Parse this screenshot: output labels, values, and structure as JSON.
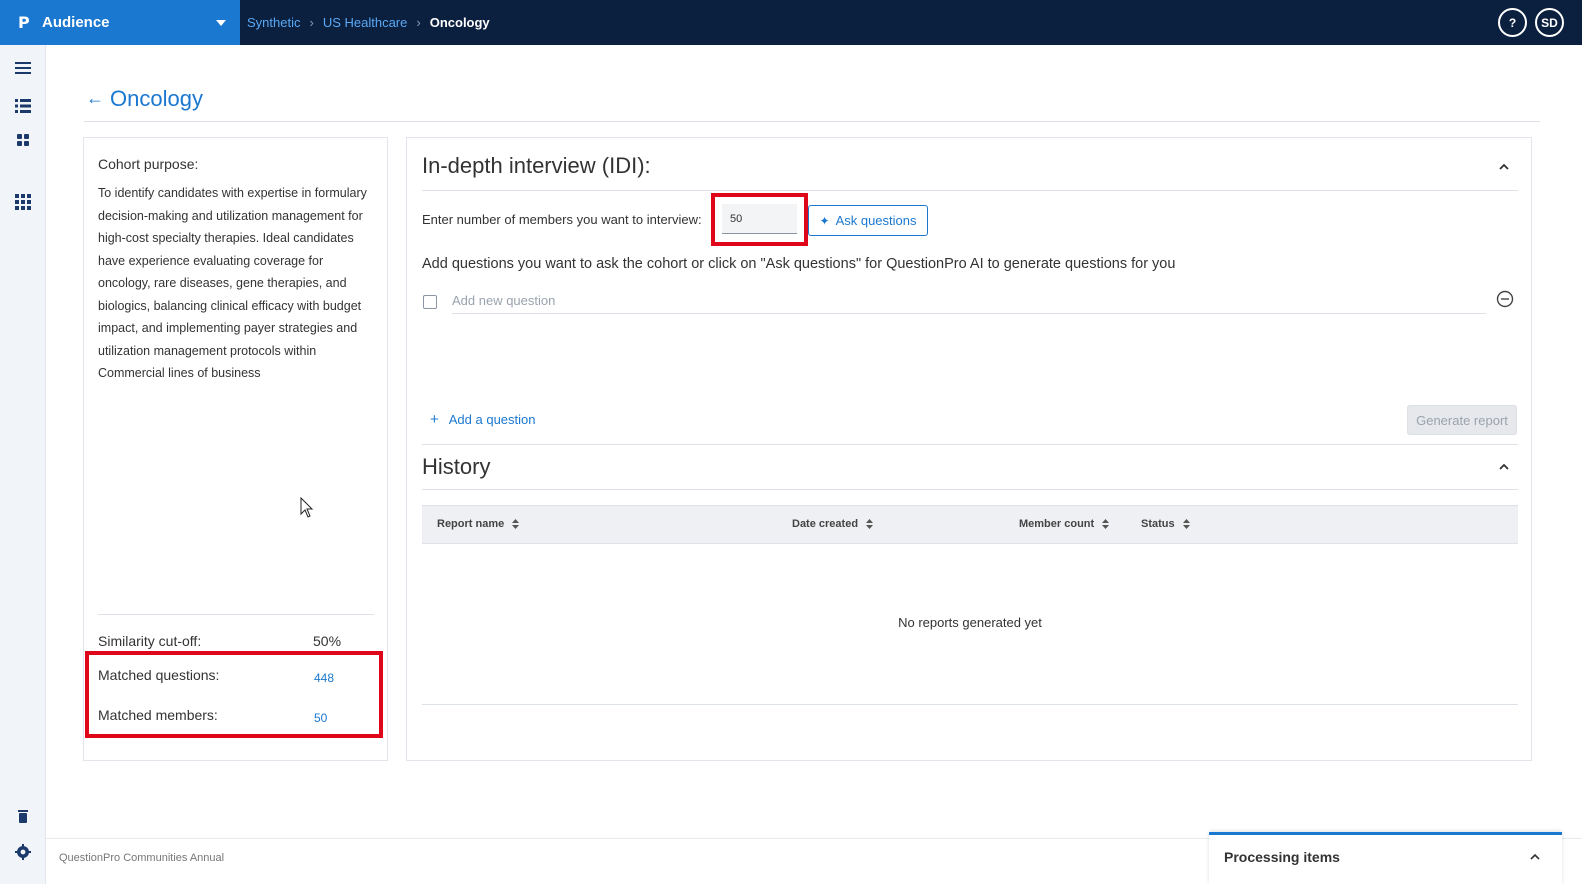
{
  "app": {
    "logo": "P",
    "name": "Audience"
  },
  "breadcrumb": {
    "items": [
      "Synthetic",
      "US Healthcare"
    ],
    "current": "Oncology"
  },
  "topbar": {
    "help_label": "?",
    "avatar_initials": "SD"
  },
  "page": {
    "title": "Oncology"
  },
  "cohort": {
    "purpose_label": "Cohort purpose:",
    "purpose_text": "To identify candidates with expertise in formulary decision-making and utilization management for high-cost specialty therapies. Ideal candidates have experience evaluating coverage for oncology, rare diseases, gene therapies, and biologics, balancing clinical efficacy with budget impact, and implementing payer strategies and utilization management protocols within Commercial lines of business",
    "similarity_label": "Similarity cut-off:",
    "similarity_value": "50%",
    "matched_questions_label": "Matched questions:",
    "matched_questions_value": "448",
    "matched_members_label": "Matched members:",
    "matched_members_value": "50"
  },
  "idi": {
    "title": "In-depth interview (IDI):",
    "members_label": "Enter number of members you want to interview:",
    "members_value": "50",
    "ask_button": "Ask questions",
    "help_text": "Add questions you want to ask the cohort or click on \"Ask questions\" for QuestionPro AI to generate questions for you",
    "new_question_placeholder": "Add new question",
    "add_question": "Add a question",
    "generate_report": "Generate report"
  },
  "history": {
    "title": "History",
    "columns": [
      "Report name",
      "Date created",
      "Member count",
      "Status"
    ],
    "empty_text": "No reports generated yet"
  },
  "footer": {
    "text": "QuestionPro Communities Annual",
    "processing_label": "Processing items"
  },
  "colors": {
    "brand_blue": "#1b78d0",
    "topbar": "#0b1f3f",
    "highlight_red": "#e0061a"
  }
}
